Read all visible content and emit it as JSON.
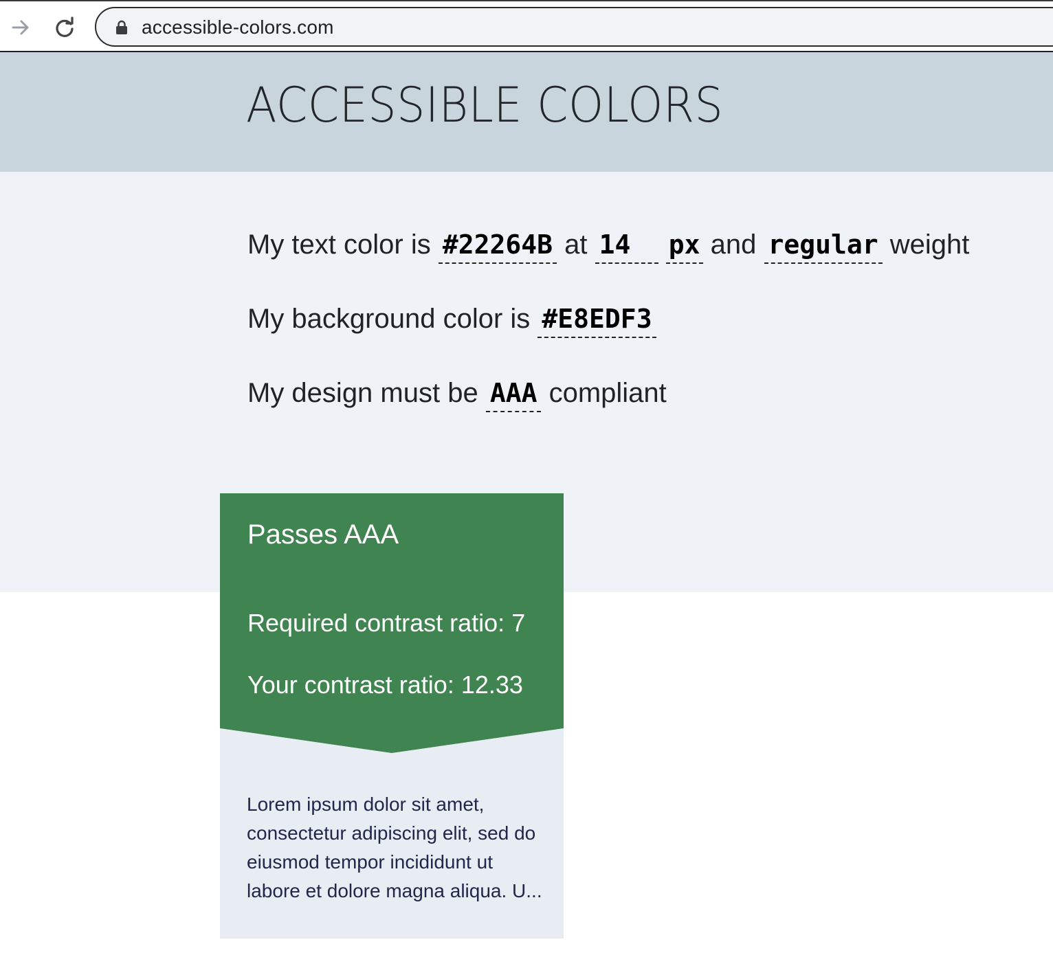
{
  "browser": {
    "url": "accessible-colors.com"
  },
  "site": {
    "title": "ACCESSIBLE COLORS"
  },
  "settings": {
    "text_color_prefix": "My text color is",
    "text_color_value": "#22264B",
    "at_label": "at",
    "font_size_value": "14",
    "font_size_unit": "px",
    "and_label": "and",
    "font_weight_value": "regular",
    "weight_label": "weight",
    "bg_color_prefix": "My background color is",
    "bg_color_value": "#E8EDF3",
    "compliance_prefix": "My design must be",
    "compliance_value": "AAA",
    "compliance_suffix": "compliant"
  },
  "result": {
    "status": "Passes AAA",
    "required_ratio": "Required contrast ratio: 7",
    "your_ratio": "Your contrast ratio: 12.33",
    "sample_text": "Lorem ipsum dolor sit amet, consectetur adipiscing elit, sed do eiusmod tempor incididunt ut labore et dolore magna aliqua. U...",
    "pass_color": "#408551"
  },
  "colors": {
    "header_bg": "#c8d5dd",
    "settings_bg": "#eff3f7",
    "sample_text_color": "#22264b",
    "sample_bg": "#e8edf3"
  },
  "icons": {
    "forward": "arrow-right-icon",
    "reload": "reload-icon",
    "lock": "lock-icon"
  }
}
